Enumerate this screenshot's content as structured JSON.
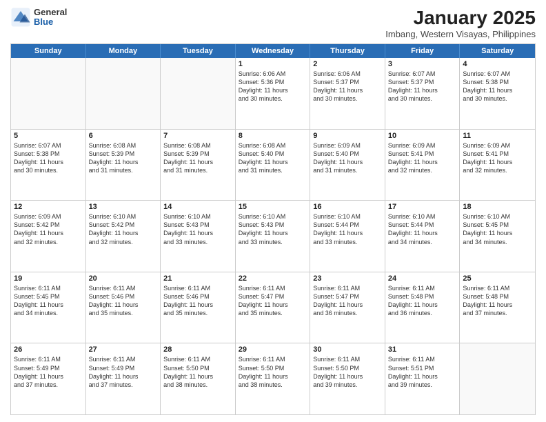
{
  "logo": {
    "general": "General",
    "blue": "Blue"
  },
  "title": {
    "month": "January 2025",
    "location": "Imbang, Western Visayas, Philippines"
  },
  "header_days": [
    "Sunday",
    "Monday",
    "Tuesday",
    "Wednesday",
    "Thursday",
    "Friday",
    "Saturday"
  ],
  "weeks": [
    [
      {
        "day": "",
        "text": ""
      },
      {
        "day": "",
        "text": ""
      },
      {
        "day": "",
        "text": ""
      },
      {
        "day": "1",
        "text": "Sunrise: 6:06 AM\nSunset: 5:36 PM\nDaylight: 11 hours\nand 30 minutes."
      },
      {
        "day": "2",
        "text": "Sunrise: 6:06 AM\nSunset: 5:37 PM\nDaylight: 11 hours\nand 30 minutes."
      },
      {
        "day": "3",
        "text": "Sunrise: 6:07 AM\nSunset: 5:37 PM\nDaylight: 11 hours\nand 30 minutes."
      },
      {
        "day": "4",
        "text": "Sunrise: 6:07 AM\nSunset: 5:38 PM\nDaylight: 11 hours\nand 30 minutes."
      }
    ],
    [
      {
        "day": "5",
        "text": "Sunrise: 6:07 AM\nSunset: 5:38 PM\nDaylight: 11 hours\nand 30 minutes."
      },
      {
        "day": "6",
        "text": "Sunrise: 6:08 AM\nSunset: 5:39 PM\nDaylight: 11 hours\nand 31 minutes."
      },
      {
        "day": "7",
        "text": "Sunrise: 6:08 AM\nSunset: 5:39 PM\nDaylight: 11 hours\nand 31 minutes."
      },
      {
        "day": "8",
        "text": "Sunrise: 6:08 AM\nSunset: 5:40 PM\nDaylight: 11 hours\nand 31 minutes."
      },
      {
        "day": "9",
        "text": "Sunrise: 6:09 AM\nSunset: 5:40 PM\nDaylight: 11 hours\nand 31 minutes."
      },
      {
        "day": "10",
        "text": "Sunrise: 6:09 AM\nSunset: 5:41 PM\nDaylight: 11 hours\nand 32 minutes."
      },
      {
        "day": "11",
        "text": "Sunrise: 6:09 AM\nSunset: 5:41 PM\nDaylight: 11 hours\nand 32 minutes."
      }
    ],
    [
      {
        "day": "12",
        "text": "Sunrise: 6:09 AM\nSunset: 5:42 PM\nDaylight: 11 hours\nand 32 minutes."
      },
      {
        "day": "13",
        "text": "Sunrise: 6:10 AM\nSunset: 5:42 PM\nDaylight: 11 hours\nand 32 minutes."
      },
      {
        "day": "14",
        "text": "Sunrise: 6:10 AM\nSunset: 5:43 PM\nDaylight: 11 hours\nand 33 minutes."
      },
      {
        "day": "15",
        "text": "Sunrise: 6:10 AM\nSunset: 5:43 PM\nDaylight: 11 hours\nand 33 minutes."
      },
      {
        "day": "16",
        "text": "Sunrise: 6:10 AM\nSunset: 5:44 PM\nDaylight: 11 hours\nand 33 minutes."
      },
      {
        "day": "17",
        "text": "Sunrise: 6:10 AM\nSunset: 5:44 PM\nDaylight: 11 hours\nand 34 minutes."
      },
      {
        "day": "18",
        "text": "Sunrise: 6:10 AM\nSunset: 5:45 PM\nDaylight: 11 hours\nand 34 minutes."
      }
    ],
    [
      {
        "day": "19",
        "text": "Sunrise: 6:11 AM\nSunset: 5:45 PM\nDaylight: 11 hours\nand 34 minutes."
      },
      {
        "day": "20",
        "text": "Sunrise: 6:11 AM\nSunset: 5:46 PM\nDaylight: 11 hours\nand 35 minutes."
      },
      {
        "day": "21",
        "text": "Sunrise: 6:11 AM\nSunset: 5:46 PM\nDaylight: 11 hours\nand 35 minutes."
      },
      {
        "day": "22",
        "text": "Sunrise: 6:11 AM\nSunset: 5:47 PM\nDaylight: 11 hours\nand 35 minutes."
      },
      {
        "day": "23",
        "text": "Sunrise: 6:11 AM\nSunset: 5:47 PM\nDaylight: 11 hours\nand 36 minutes."
      },
      {
        "day": "24",
        "text": "Sunrise: 6:11 AM\nSunset: 5:48 PM\nDaylight: 11 hours\nand 36 minutes."
      },
      {
        "day": "25",
        "text": "Sunrise: 6:11 AM\nSunset: 5:48 PM\nDaylight: 11 hours\nand 37 minutes."
      }
    ],
    [
      {
        "day": "26",
        "text": "Sunrise: 6:11 AM\nSunset: 5:49 PM\nDaylight: 11 hours\nand 37 minutes."
      },
      {
        "day": "27",
        "text": "Sunrise: 6:11 AM\nSunset: 5:49 PM\nDaylight: 11 hours\nand 37 minutes."
      },
      {
        "day": "28",
        "text": "Sunrise: 6:11 AM\nSunset: 5:50 PM\nDaylight: 11 hours\nand 38 minutes."
      },
      {
        "day": "29",
        "text": "Sunrise: 6:11 AM\nSunset: 5:50 PM\nDaylight: 11 hours\nand 38 minutes."
      },
      {
        "day": "30",
        "text": "Sunrise: 6:11 AM\nSunset: 5:50 PM\nDaylight: 11 hours\nand 39 minutes."
      },
      {
        "day": "31",
        "text": "Sunrise: 6:11 AM\nSunset: 5:51 PM\nDaylight: 11 hours\nand 39 minutes."
      },
      {
        "day": "",
        "text": ""
      }
    ]
  ]
}
